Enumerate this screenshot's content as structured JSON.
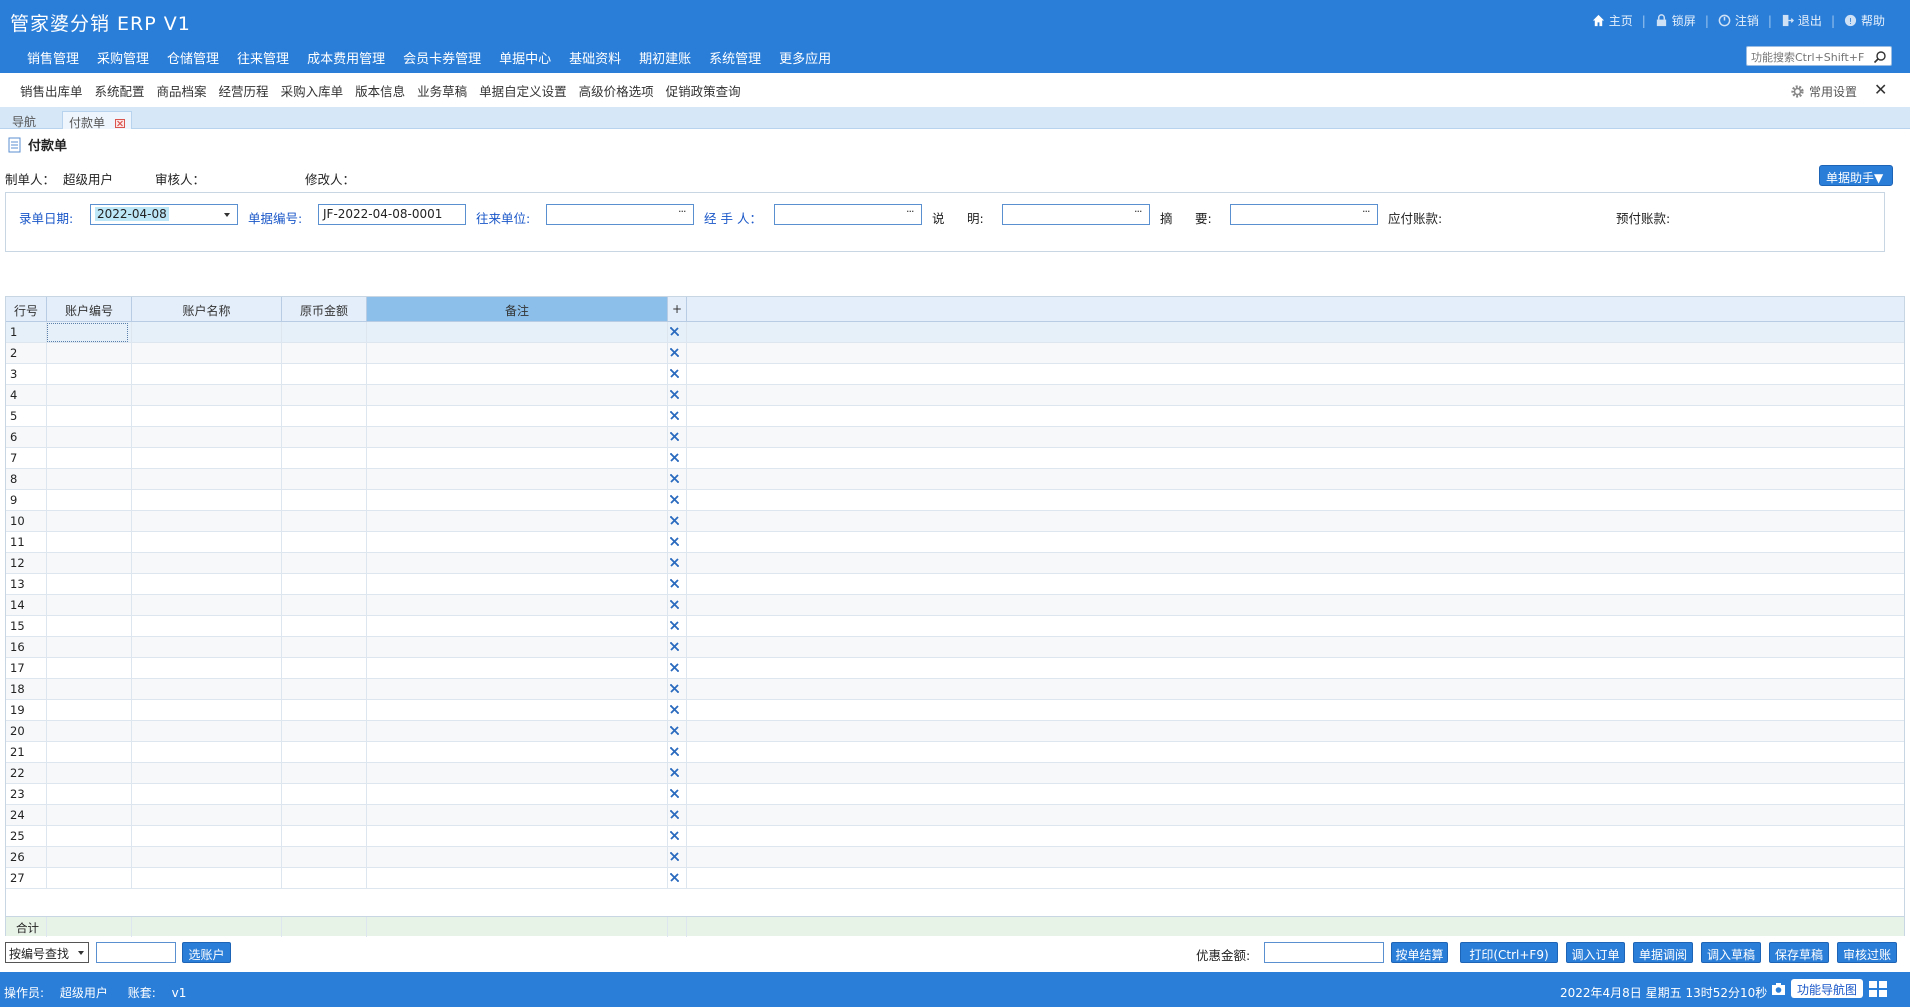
{
  "app": {
    "title": "管家婆分销 ERP V1"
  },
  "top_links": [
    {
      "label": "主页",
      "icon": "home-icon"
    },
    {
      "label": "锁屏",
      "icon": "lock-icon"
    },
    {
      "label": "注销",
      "icon": "logout-icon"
    },
    {
      "label": "退出",
      "icon": "exit-icon"
    },
    {
      "label": "帮助",
      "icon": "help-icon"
    }
  ],
  "menu": [
    "销售管理",
    "采购管理",
    "仓储管理",
    "往来管理",
    "成本费用管理",
    "会员卡券管理",
    "单据中心",
    "基础资料",
    "期初建账",
    "系统管理",
    "更多应用"
  ],
  "func_search": {
    "placeholder": "功能搜索Ctrl+Shift+F"
  },
  "shortcuts": [
    "销售出库单",
    "系统配置",
    "商品档案",
    "经营历程",
    "采购入库单",
    "版本信息",
    "业务草稿",
    "单据自定义设置",
    "高级价格选项",
    "促销政策查询"
  ],
  "common_settings": "常用设置",
  "tabs": {
    "nav": "导航",
    "current": "付款单"
  },
  "form": {
    "title": "付款单",
    "creator_label": "制单人：",
    "creator": "超级用户",
    "reviewer_label": "审核人：",
    "reviewer": "",
    "modifier_label": "修改人：",
    "modifier": "",
    "helper_button": "单据助手▼"
  },
  "header_fields": {
    "date_label": "录单日期:",
    "date_value": "2022-04-08",
    "number_label": "单据编号:",
    "number_value": "JF-2022-04-08-0001",
    "partner_label": "往来单位:",
    "handler_label": "经 手 人：",
    "desc_label1": "说",
    "desc_label2": "明:",
    "summary_label1": "摘",
    "summary_label2": "要:",
    "payable_label": "应付账款:",
    "prepaid_label": "预付账款:",
    "ellipsis": "···"
  },
  "grid": {
    "columns": [
      "行号",
      "账户编号",
      "账户名称",
      "原币金额",
      "备注",
      "+"
    ],
    "row_count": 27,
    "rows": [
      "1",
      "2",
      "3",
      "4",
      "5",
      "6",
      "7",
      "8",
      "9",
      "10",
      "11",
      "12",
      "13",
      "14",
      "15",
      "16",
      "17",
      "18",
      "19",
      "20",
      "21",
      "22",
      "23",
      "24",
      "25",
      "26",
      "27"
    ],
    "sum_label": "合计"
  },
  "footer": {
    "query_select": "按编号查找",
    "choose_account": "选账户",
    "discount_label": "优惠金额:",
    "buttons": [
      "按单结算",
      "打印(Ctrl+F9)",
      "调入订单",
      "单据调阅",
      "调入草稿",
      "保存草稿",
      "审核过账"
    ]
  },
  "status": {
    "operator_label": "操作员:",
    "operator": "超级用户",
    "account_label": "账套:",
    "account": "v1",
    "datetime": "2022年4月8日  星期五  13时52分10秒",
    "nav_map": "功能导航图"
  },
  "colors": {
    "brand": "#2b7ed8",
    "header_selected": "#8cc0ea",
    "label_blue": "#1a57c8"
  }
}
